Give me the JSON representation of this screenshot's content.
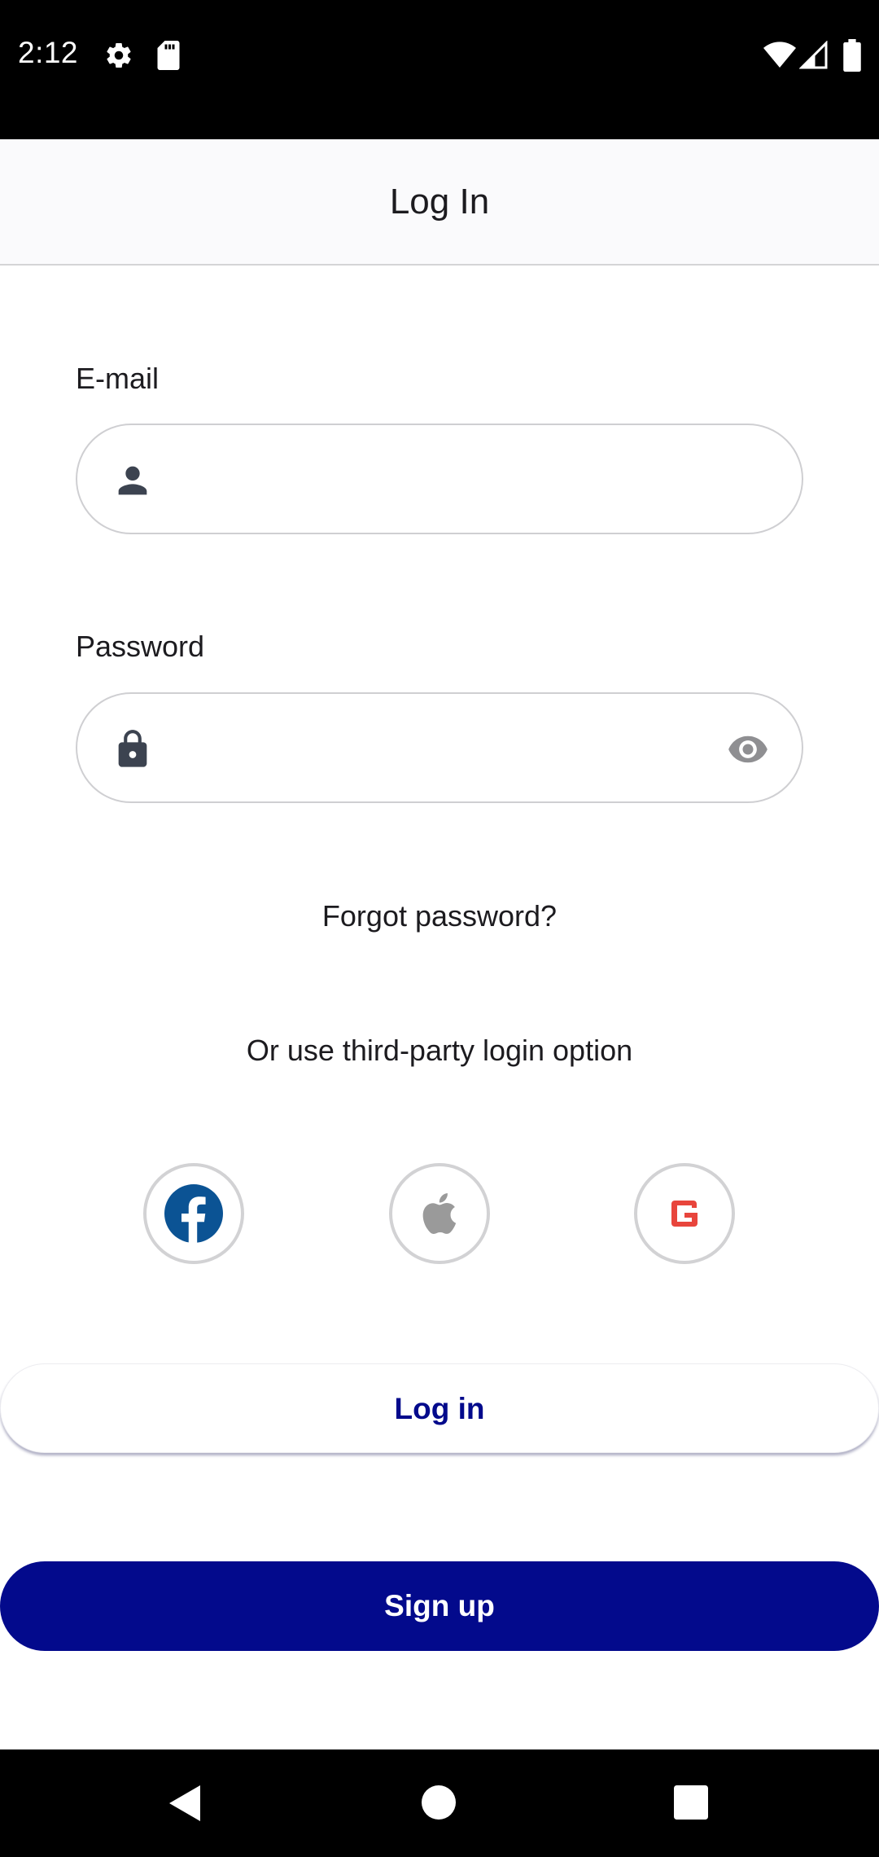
{
  "status_bar": {
    "time": "2:12",
    "icons": [
      "settings-icon",
      "sd-card-icon",
      "wifi-icon",
      "signal-icon",
      "battery-icon"
    ]
  },
  "app_bar": {
    "title": "Log In"
  },
  "form": {
    "email": {
      "label": "E-mail",
      "value": "",
      "icon": "person-icon"
    },
    "password": {
      "label": "Password",
      "value": "",
      "icon": "lock-icon",
      "toggle_icon": "eye-icon"
    }
  },
  "forgot_password": "Forgot password?",
  "third_party": {
    "label": "Or use third-party login option",
    "providers": [
      {
        "name": "facebook",
        "icon": "facebook-icon",
        "color": "#0b5394"
      },
      {
        "name": "apple",
        "icon": "apple-icon",
        "color": "#9a9a9a"
      },
      {
        "name": "google",
        "icon": "google-icon",
        "color": "#e8453c"
      }
    ]
  },
  "buttons": {
    "login": "Log in",
    "signup": "Sign up"
  },
  "colors": {
    "primary": "#030a8c",
    "app_bar_bg": "#fafafc",
    "input_border": "#cfcfd2",
    "icon_dark": "#3c4350"
  },
  "nav_bar": {
    "icons": [
      "back-icon",
      "home-icon",
      "recents-icon"
    ]
  }
}
